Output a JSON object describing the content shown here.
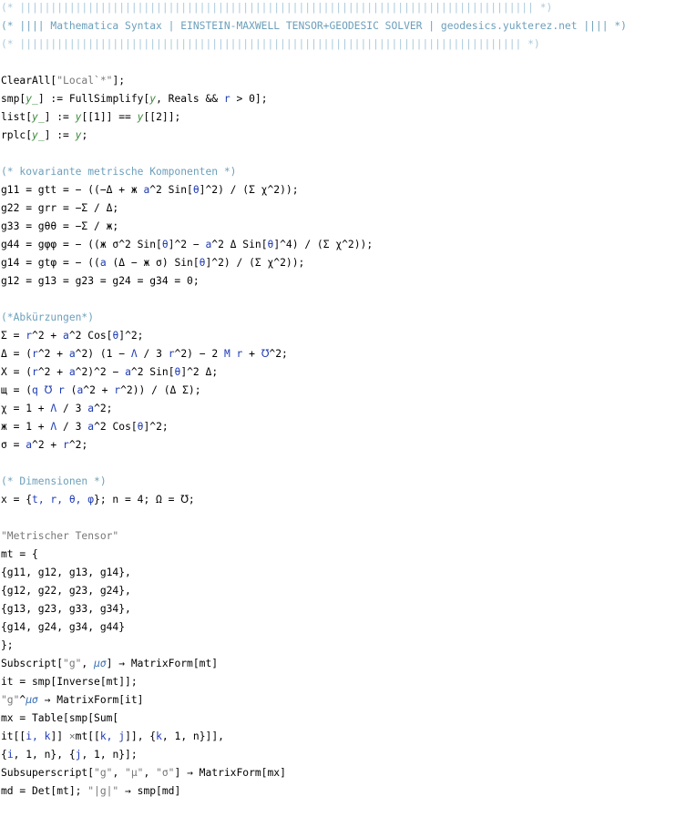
{
  "header": {
    "line1": "(* ||||||||||||||||||||||||||||||||||||||||||||||||||||||||||||||||||||||||||||||||||| *)",
    "line2": "(* |||| Mathematica Syntax | EINSTEIN-MAXWELL TENSOR+GEODESIC SOLVER | geodesics.yukterez.net |||| *)",
    "line3": "(* ||||||||||||||||||||||||||||||||||||||||||||||||||||||||||||||||||||||||||||||||| *)"
  },
  "code": {
    "clearall": [
      {
        "t": "ClearAll["
      },
      {
        "t": "\"Local`*\"",
        "c": "st"
      },
      {
        "t": "];"
      }
    ],
    "smp": [
      {
        "t": "smp["
      },
      {
        "t": "y_",
        "c": "gv"
      },
      {
        "t": "] := FullSimplify["
      },
      {
        "t": "y",
        "c": "gv"
      },
      {
        "t": ", Reals && "
      },
      {
        "t": "r",
        "c": "sy"
      },
      {
        "t": " > 0];"
      }
    ],
    "list": [
      {
        "t": "list["
      },
      {
        "t": "y_",
        "c": "gv"
      },
      {
        "t": "] := "
      },
      {
        "t": "y",
        "c": "gv"
      },
      {
        "t": "[[1]] == "
      },
      {
        "t": "y",
        "c": "gv"
      },
      {
        "t": "[[2]];"
      }
    ],
    "rplc": [
      {
        "t": "rplc["
      },
      {
        "t": "y_",
        "c": "gv"
      },
      {
        "t": "] := "
      },
      {
        "t": "y",
        "c": "gv"
      },
      {
        "t": ";"
      }
    ],
    "comment_metric": [
      {
        "t": "(* kovariante metrische Komponenten *)",
        "c": "cm"
      }
    ],
    "g11": [
      {
        "t": "g11 = gtt = − ((−Δ + ж "
      },
      {
        "t": "a",
        "c": "sy"
      },
      {
        "t": "^2 Sin["
      },
      {
        "t": "θ",
        "c": "sy"
      },
      {
        "t": "]^2) / (Σ χ^2));"
      }
    ],
    "g22": [
      {
        "t": "g22 = grr = −Σ / Δ;"
      }
    ],
    "g33": [
      {
        "t": "g33 = gθθ = −Σ / ж;"
      }
    ],
    "g44": [
      {
        "t": "g44 = gφφ = − ((ж σ^2 Sin["
      },
      {
        "t": "θ",
        "c": "sy"
      },
      {
        "t": "]^2 − "
      },
      {
        "t": "a",
        "c": "sy"
      },
      {
        "t": "^2 Δ Sin["
      },
      {
        "t": "θ",
        "c": "sy"
      },
      {
        "t": "]^4) / (Σ χ^2));"
      }
    ],
    "g14": [
      {
        "t": "g14 = gtφ = − (("
      },
      {
        "t": "a",
        "c": "sy"
      },
      {
        "t": " (Δ − ж σ) Sin["
      },
      {
        "t": "θ",
        "c": "sy"
      },
      {
        "t": "]^2) / (Σ χ^2));"
      }
    ],
    "g12": [
      {
        "t": "g12 = g13 = g23 = g24 = g34 = 0;"
      }
    ],
    "comment_abk": [
      {
        "t": "(*Abkürzungen*)",
        "c": "cm"
      }
    ],
    "sigma": [
      {
        "t": "Σ = "
      },
      {
        "t": "r",
        "c": "sy"
      },
      {
        "t": "^2 + "
      },
      {
        "t": "a",
        "c": "sy"
      },
      {
        "t": "^2 Cos["
      },
      {
        "t": "θ",
        "c": "sy"
      },
      {
        "t": "]^2;"
      }
    ],
    "delta": [
      {
        "t": "Δ = ("
      },
      {
        "t": "r",
        "c": "sy"
      },
      {
        "t": "^2 + "
      },
      {
        "t": "a",
        "c": "sy"
      },
      {
        "t": "^2) (1 − "
      },
      {
        "t": "Λ",
        "c": "sy"
      },
      {
        "t": " / 3 "
      },
      {
        "t": "r",
        "c": "sy"
      },
      {
        "t": "^2) − 2 "
      },
      {
        "t": "M r",
        "c": "sy"
      },
      {
        "t": " + "
      },
      {
        "t": "℧",
        "c": "sy"
      },
      {
        "t": "^2;"
      }
    ],
    "chi_big": [
      {
        "t": "Χ = ("
      },
      {
        "t": "r",
        "c": "sy"
      },
      {
        "t": "^2 + "
      },
      {
        "t": "a",
        "c": "sy"
      },
      {
        "t": "^2)^2 − "
      },
      {
        "t": "a",
        "c": "sy"
      },
      {
        "t": "^2 Sin["
      },
      {
        "t": "θ",
        "c": "sy"
      },
      {
        "t": "]^2 Δ;"
      }
    ],
    "shch": [
      {
        "t": "щ = ("
      },
      {
        "t": "q ℧ r",
        "c": "sy"
      },
      {
        "t": " ("
      },
      {
        "t": "a",
        "c": "sy"
      },
      {
        "t": "^2 + "
      },
      {
        "t": "r",
        "c": "sy"
      },
      {
        "t": "^2)) / (Δ Σ);"
      }
    ],
    "chi": [
      {
        "t": "χ = 1 + "
      },
      {
        "t": "Λ",
        "c": "sy"
      },
      {
        "t": " / 3 "
      },
      {
        "t": "a",
        "c": "sy"
      },
      {
        "t": "^2;"
      }
    ],
    "zhe": [
      {
        "t": "ж = 1 + "
      },
      {
        "t": "Λ",
        "c": "sy"
      },
      {
        "t": " / 3 "
      },
      {
        "t": "a",
        "c": "sy"
      },
      {
        "t": "^2 Cos["
      },
      {
        "t": "θ",
        "c": "sy"
      },
      {
        "t": "]^2;"
      }
    ],
    "sigma_small": [
      {
        "t": "σ = "
      },
      {
        "t": "a",
        "c": "sy"
      },
      {
        "t": "^2 + "
      },
      {
        "t": "r",
        "c": "sy"
      },
      {
        "t": "^2;"
      }
    ],
    "comment_dim": [
      {
        "t": "(* Dimensionen *)",
        "c": "cm"
      }
    ],
    "dims": [
      {
        "t": "x = {"
      },
      {
        "t": "t, r, θ, φ",
        "c": "sy"
      },
      {
        "t": "}; n = 4; Ω = ℧;"
      }
    ],
    "str_metric": [
      {
        "t": "\"Metrischer Tensor\"",
        "c": "st"
      }
    ],
    "mt_open": [
      {
        "t": "mt = {"
      }
    ],
    "row1": [
      {
        "t": "{g11, g12, g13, g14},"
      }
    ],
    "row2": [
      {
        "t": "{g12, g22, g23, g24},"
      }
    ],
    "row3": [
      {
        "t": "{g13, g23, g33, g34},"
      }
    ],
    "row4": [
      {
        "t": "{g14, g24, g34, g44}"
      }
    ],
    "mt_close": [
      {
        "t": "};"
      }
    ],
    "subscript": [
      {
        "t": "Subscript["
      },
      {
        "t": "\"g\"",
        "c": "st"
      },
      {
        "t": ", "
      },
      {
        "t": "μσ",
        "c": "gk"
      },
      {
        "t": "] → MatrixForm[mt]"
      }
    ],
    "it": [
      {
        "t": "it = smp[Inverse[mt]];"
      }
    ],
    "g_up": [
      {
        "t": "\"g\"",
        "c": "st"
      },
      {
        "t": "^"
      },
      {
        "t": "μσ",
        "c": "gk"
      },
      {
        "t": " → MatrixForm[it]"
      }
    ],
    "mx1": [
      {
        "t": "mx = Table[smp[Sum["
      }
    ],
    "mx2": [
      {
        "t": "it[["
      },
      {
        "t": "i, k",
        "c": "sy"
      },
      {
        "t": "]] "
      },
      {
        "t": "×",
        "c": "st"
      },
      {
        "t": "mt[["
      },
      {
        "t": "k, j",
        "c": "sy"
      },
      {
        "t": "]], {"
      },
      {
        "t": "k",
        "c": "sy"
      },
      {
        "t": ", 1, n}]],"
      }
    ],
    "mx3": [
      {
        "t": "{"
      },
      {
        "t": "i",
        "c": "sy"
      },
      {
        "t": ", 1, n}, {"
      },
      {
        "t": "j",
        "c": "sy"
      },
      {
        "t": ", 1, n}];"
      }
    ],
    "subsup": [
      {
        "t": "Subsuperscript["
      },
      {
        "t": "\"g\"",
        "c": "st"
      },
      {
        "t": ", "
      },
      {
        "t": "\"μ\"",
        "c": "st"
      },
      {
        "t": ", "
      },
      {
        "t": "\"σ\"",
        "c": "st"
      },
      {
        "t": "] → MatrixForm[mx]"
      }
    ],
    "md": [
      {
        "t": "md = Det[mt]; "
      },
      {
        "t": "\"|g|\"",
        "c": "st"
      },
      {
        "t": " → smp[md]"
      }
    ]
  },
  "colors": {
    "comment": "#6c9fbb",
    "string": "#777777",
    "symbol": "#1d3bb3",
    "pattern": "#3b8a3b"
  }
}
